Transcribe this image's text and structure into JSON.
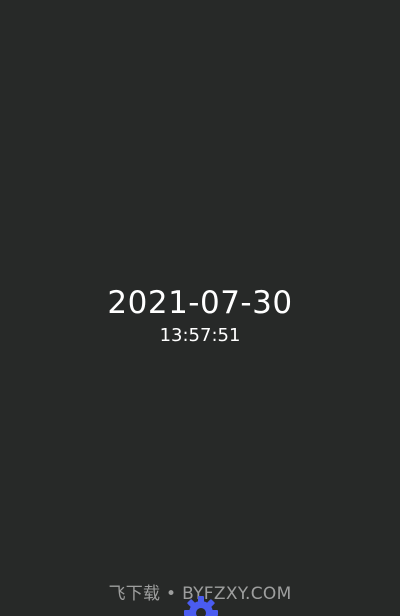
{
  "clock": {
    "date": "2021-07-30",
    "time": "13:57:51"
  },
  "watermark": {
    "text": "飞下载 • BYFZXY.COM"
  },
  "icons": {
    "settings": "gear-icon"
  },
  "colors": {
    "background": "#272928",
    "text": "#ffffff",
    "gear": "#4a5cf0"
  }
}
